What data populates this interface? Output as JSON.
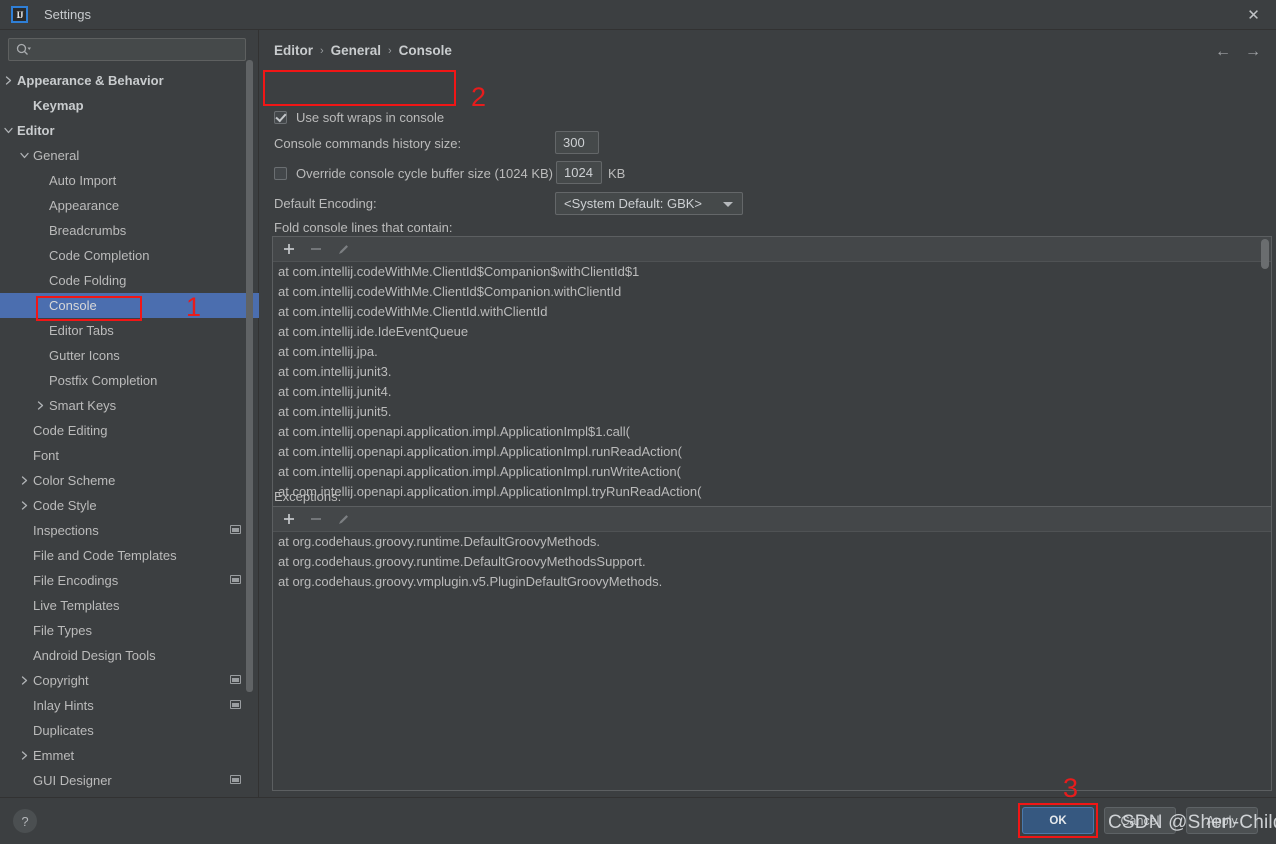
{
  "window": {
    "title": "Settings",
    "logo_text": "IJ",
    "close_label": "✕"
  },
  "search": {
    "placeholder": "",
    "value": "",
    "icon": "search-icon"
  },
  "sidebar": {
    "items": [
      {
        "label": "Appearance & Behavior",
        "indent": 1,
        "twisty": "collapsed",
        "bold": true,
        "selected": false,
        "badge": false
      },
      {
        "label": "Keymap",
        "indent": 2,
        "twisty": "none",
        "bold": true,
        "selected": false,
        "badge": false
      },
      {
        "label": "Editor",
        "indent": 1,
        "twisty": "expanded",
        "bold": true,
        "selected": false,
        "badge": false
      },
      {
        "label": "General",
        "indent": 2,
        "twisty": "expanded",
        "bold": false,
        "selected": false,
        "badge": false
      },
      {
        "label": "Auto Import",
        "indent": 3,
        "twisty": "none",
        "bold": false,
        "selected": false,
        "badge": false
      },
      {
        "label": "Appearance",
        "indent": 3,
        "twisty": "none",
        "bold": false,
        "selected": false,
        "badge": false
      },
      {
        "label": "Breadcrumbs",
        "indent": 3,
        "twisty": "none",
        "bold": false,
        "selected": false,
        "badge": false
      },
      {
        "label": "Code Completion",
        "indent": 3,
        "twisty": "none",
        "bold": false,
        "selected": false,
        "badge": false
      },
      {
        "label": "Code Folding",
        "indent": 3,
        "twisty": "none",
        "bold": false,
        "selected": false,
        "badge": false
      },
      {
        "label": "Console",
        "indent": 3,
        "twisty": "none",
        "bold": false,
        "selected": true,
        "badge": false
      },
      {
        "label": "Editor Tabs",
        "indent": 3,
        "twisty": "none",
        "bold": false,
        "selected": false,
        "badge": false
      },
      {
        "label": "Gutter Icons",
        "indent": 3,
        "twisty": "none",
        "bold": false,
        "selected": false,
        "badge": false
      },
      {
        "label": "Postfix Completion",
        "indent": 3,
        "twisty": "none",
        "bold": false,
        "selected": false,
        "badge": false
      },
      {
        "label": "Smart Keys",
        "indent": 3,
        "twisty": "collapsed",
        "bold": false,
        "selected": false,
        "badge": false
      },
      {
        "label": "Code Editing",
        "indent": 2,
        "twisty": "none",
        "bold": false,
        "selected": false,
        "badge": false
      },
      {
        "label": "Font",
        "indent": 2,
        "twisty": "none",
        "bold": false,
        "selected": false,
        "badge": false
      },
      {
        "label": "Color Scheme",
        "indent": 2,
        "twisty": "collapsed",
        "bold": false,
        "selected": false,
        "badge": false
      },
      {
        "label": "Code Style",
        "indent": 2,
        "twisty": "collapsed",
        "bold": false,
        "selected": false,
        "badge": false
      },
      {
        "label": "Inspections",
        "indent": 2,
        "twisty": "none",
        "bold": false,
        "selected": false,
        "badge": true
      },
      {
        "label": "File and Code Templates",
        "indent": 2,
        "twisty": "none",
        "bold": false,
        "selected": false,
        "badge": false
      },
      {
        "label": "File Encodings",
        "indent": 2,
        "twisty": "none",
        "bold": false,
        "selected": false,
        "badge": true
      },
      {
        "label": "Live Templates",
        "indent": 2,
        "twisty": "none",
        "bold": false,
        "selected": false,
        "badge": false
      },
      {
        "label": "File Types",
        "indent": 2,
        "twisty": "none",
        "bold": false,
        "selected": false,
        "badge": false
      },
      {
        "label": "Android Design Tools",
        "indent": 2,
        "twisty": "none",
        "bold": false,
        "selected": false,
        "badge": false
      },
      {
        "label": "Copyright",
        "indent": 2,
        "twisty": "collapsed",
        "bold": false,
        "selected": false,
        "badge": true
      },
      {
        "label": "Inlay Hints",
        "indent": 2,
        "twisty": "none",
        "bold": false,
        "selected": false,
        "badge": true
      },
      {
        "label": "Duplicates",
        "indent": 2,
        "twisty": "none",
        "bold": false,
        "selected": false,
        "badge": false
      },
      {
        "label": "Emmet",
        "indent": 2,
        "twisty": "collapsed",
        "bold": false,
        "selected": false,
        "badge": false
      },
      {
        "label": "GUI Designer",
        "indent": 2,
        "twisty": "none",
        "bold": false,
        "selected": false,
        "badge": true
      }
    ]
  },
  "main": {
    "breadcrumb": [
      "Editor",
      "General",
      "Console"
    ],
    "breadcrumb_sep": "›",
    "nav_back": "←",
    "nav_forward": "→",
    "soft_wraps": {
      "label": "Use soft wraps in console",
      "checked": true
    },
    "history_size": {
      "label": "Console commands history size:",
      "value": "300"
    },
    "cycle_buffer": {
      "label": "Override console cycle buffer size (1024 KB)",
      "checked": false,
      "value": "1024",
      "unit": "KB"
    },
    "encoding": {
      "label": "Default Encoding:",
      "value": "<System Default: GBK>"
    },
    "fold_lines": {
      "label": "Fold console lines that contain:",
      "toolbar": {
        "add": "+",
        "remove": "−",
        "edit": "pencil-icon"
      },
      "items": [
        "at com.intellij.codeWithMe.ClientId$Companion$withClientId$1",
        "at com.intellij.codeWithMe.ClientId$Companion.withClientId",
        "at com.intellij.codeWithMe.ClientId.withClientId",
        "at com.intellij.ide.IdeEventQueue",
        "at com.intellij.jpa.",
        "at com.intellij.junit3.",
        "at com.intellij.junit4.",
        "at com.intellij.junit5.",
        "at com.intellij.openapi.application.impl.ApplicationImpl$1.call(",
        "at com.intellij.openapi.application.impl.ApplicationImpl.runReadAction(",
        "at com.intellij.openapi.application.impl.ApplicationImpl.runWriteAction(",
        "at com.intellij.openapi.application.impl.ApplicationImpl.tryRunReadAction("
      ]
    },
    "exceptions": {
      "label": "Exceptions:",
      "toolbar": {
        "add": "+",
        "remove": "−",
        "edit": "pencil-icon"
      },
      "items": [
        "at org.codehaus.groovy.runtime.DefaultGroovyMethods.",
        "at org.codehaus.groovy.runtime.DefaultGroovyMethodsSupport.",
        "at org.codehaus.groovy.vmplugin.v5.PluginDefaultGroovyMethods."
      ]
    }
  },
  "footer": {
    "help": "?",
    "ok": "OK",
    "cancel": "Cancel",
    "apply": "Apply"
  },
  "annotations": {
    "one": "1",
    "two": "2",
    "three": "3",
    "color": "#e81c1c"
  },
  "watermark": "CSDN @Shen-Childe"
}
